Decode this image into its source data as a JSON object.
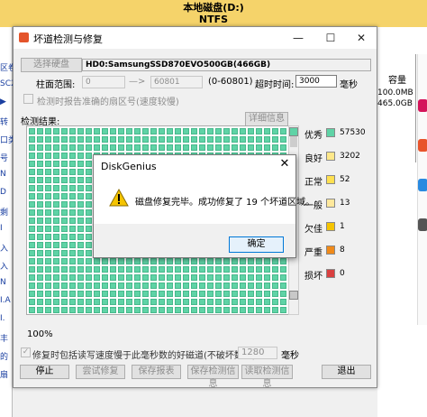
{
  "background": {
    "title": "本地磁盘(D:)",
    "fs": "NTFS",
    "left_frags": [
      "区卷",
      "SC2",
      "▶",
      "转",
      "口类",
      "号",
      "N",
      "D",
      "剩",
      "I",
      "入",
      "入",
      "N",
      "I.A",
      "I.",
      "丰",
      "的",
      "扇"
    ],
    "right_header": "容量",
    "right_sizes": [
      "100.0MB",
      "465.0GB"
    ],
    "side_icon_colors": [
      "#d4145a",
      "#e8542b",
      "#2a8ae0",
      "#555555"
    ]
  },
  "dialog": {
    "title": "坏道检测与修复",
    "controls": {
      "minimize": "—",
      "maximize": "☐",
      "close": "✕"
    },
    "select_disk_label": "选择硬盘",
    "disk_name": "HD0:SamsungSSD870EVO500GB(466GB)",
    "cylinder_label": "柱面范围:",
    "cyl_from": "0",
    "cyl_arrow": "—>",
    "cyl_to": "60801",
    "cyl_range_hint": "(0-60801)",
    "timeout_label": "超时时间:",
    "timeout_value": "3000",
    "timeout_unit": "毫秒",
    "report_sector_label": "检测时报告准确的扇区号(速度较慢)",
    "result_label": "检测结果:",
    "detail_button": "详细信息",
    "progress": "100%",
    "repair_option_label": "修复时包括读写速度慢于此毫秒数的好磁道(不破坏数据):",
    "repair_ms_value": "1280",
    "repair_ms_unit": "毫秒",
    "buttons": {
      "stop": "停止",
      "try_repair": "尝试修复",
      "save_report": "保存报表",
      "save_state": "保存检测信息",
      "load_state": "读取检测信息",
      "exit": "退出"
    },
    "legend": [
      {
        "label": "优秀",
        "count": "57530",
        "color": "#5fd3a6"
      },
      {
        "label": "良好",
        "count": "3202",
        "color": "#ffe88a"
      },
      {
        "label": "正常",
        "count": "52",
        "color": "#ffe050"
      },
      {
        "label": "一般",
        "count": "13",
        "color": "#ffe89c"
      },
      {
        "label": "欠佳",
        "count": "1",
        "color": "#f5c400"
      },
      {
        "label": "严重",
        "count": "8",
        "color": "#f08a1a"
      },
      {
        "label": "损坏",
        "count": "0",
        "color": "#d94040"
      }
    ],
    "legend_side_colors": [
      "#5fd3a6",
      "#c8c8c8"
    ]
  },
  "message_box": {
    "title": "DiskGenius",
    "close": "✕",
    "text": "磁盘修复完毕。成功修复了 19 个坏道区域。",
    "ok": "确定",
    "icon": "warning-icon"
  }
}
